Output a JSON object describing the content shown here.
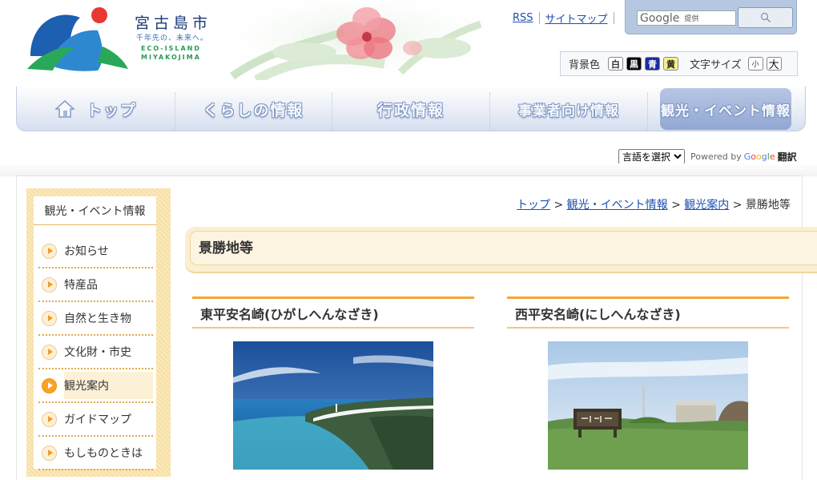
{
  "header": {
    "city_name": "宮古島市",
    "tagline": "千年先の、未来へ。",
    "eco_line1": "ECO-ISLAND",
    "eco_line2": "MIYAKOJIMA"
  },
  "util_links": {
    "rss": "RSS",
    "sitemap": "サイトマップ"
  },
  "search": {
    "google_label": "Google",
    "provided_label": "提供"
  },
  "prefs": {
    "bg_label": "背景色",
    "bg_white": "白",
    "bg_black": "黒",
    "bg_blue": "青",
    "bg_yellow": "黄",
    "font_label": "文字サイズ",
    "font_small": "小",
    "font_large": "大"
  },
  "nav": {
    "top": "トップ",
    "living": "くらしの情報",
    "admin": "行政情報",
    "business": "事業者向け情報",
    "tourism": "観光・イベント情報"
  },
  "translate": {
    "select_label": "言語を選択",
    "powered_by": "Powered by",
    "google": "Google",
    "translate_label": "翻訳"
  },
  "side_menu": {
    "title": "観光・イベント情報",
    "items": [
      {
        "label": "お知らせ"
      },
      {
        "label": "特産品"
      },
      {
        "label": "自然と生き物"
      },
      {
        "label": "文化財・市史"
      },
      {
        "label": "観光案内"
      },
      {
        "label": "ガイドマップ"
      },
      {
        "label": "もしものときは"
      }
    ]
  },
  "breadcrumb": {
    "top": "トップ",
    "tourism": "観光・イベント情報",
    "guide": "観光案内",
    "current": "景勝地等"
  },
  "page_title": "景勝地等",
  "spots": [
    {
      "title": "東平安名崎(ひがしへんなざき)"
    },
    {
      "title": "西平安名崎(にしへんなざき)"
    }
  ],
  "colors": {
    "link": "#1c50b0",
    "accent_orange": "#f5a630",
    "nav_blue": "#91a7d3"
  }
}
